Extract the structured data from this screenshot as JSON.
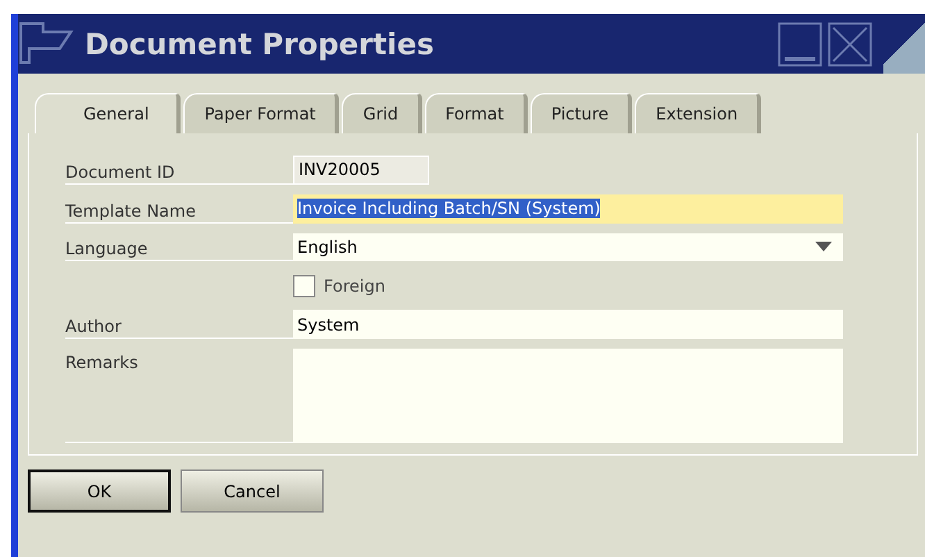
{
  "window": {
    "title": "Document Properties"
  },
  "tabs": [
    {
      "label": "General",
      "selected": true
    },
    {
      "label": "Paper Format",
      "selected": false
    },
    {
      "label": "Grid",
      "selected": false
    },
    {
      "label": "Format",
      "selected": false
    },
    {
      "label": "Picture",
      "selected": false
    },
    {
      "label": "Extension",
      "selected": false
    }
  ],
  "fields": [
    {
      "kind": "readonly",
      "label": "Document ID",
      "value": "INV20005"
    },
    {
      "kind": "text",
      "label": "Template Name",
      "value": "Invoice Including Batch/SN (System)",
      "focused": true,
      "text_selected": true
    },
    {
      "kind": "dropdown",
      "label": "Language",
      "value": "English"
    },
    {
      "kind": "checkbox",
      "label": "Foreign",
      "checked": false
    },
    {
      "kind": "text",
      "label": "Author",
      "value": "System",
      "focused": false,
      "text_selected": false
    },
    {
      "kind": "textarea",
      "label": "Remarks"
    }
  ],
  "buttons": [
    {
      "label": "OK",
      "default": true
    },
    {
      "label": "Cancel",
      "default": false
    }
  ]
}
